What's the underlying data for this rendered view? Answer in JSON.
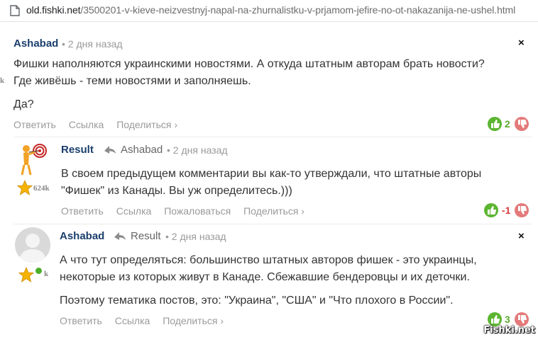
{
  "browser": {
    "url_domain": "old.fishki.net",
    "url_path": "/3500201-v-kieve-neizvestnyj-napal-na-zhurnalistku-v-prjamom-jefire-no-ot-nakazanija-ne-ushel.html"
  },
  "comments": [
    {
      "author": "Ashabad",
      "time": "• 2 дня назад",
      "rating_partial": "k",
      "body": [
        "Фишки наполняются украинскими новостями. А откуда штатным авторам брать новости?",
        "Где живёшь - теми новостями и заполняешь.",
        "Да?"
      ],
      "actions": [
        "Ответить",
        "Ссылка",
        "Поделиться ›"
      ],
      "score": "2",
      "close_label": "×"
    },
    {
      "author": "Result",
      "reply_to": "Ashabad",
      "time": "• 2 дня назад",
      "rating": "624k",
      "body": [
        "В своем предыдущем комментарии вы как-то утверждали, что штатные авторы",
        "\"Фишек\" из Канады. Вы уж определитесь.)))"
      ],
      "actions": [
        "Ответить",
        "Ссылка",
        "Пожаловаться",
        "Поделиться ›"
      ],
      "score": "-1"
    },
    {
      "author": "Ashabad",
      "reply_to": "Result",
      "time": "• 2 дня назад",
      "rating_partial": "k",
      "body": [
        "А что тут определяться: большинство штатных авторов фишек - это украинцы,",
        "некоторые из которых живут в Канаде. Сбежавшие бендеровцы и их деточки.",
        "Поэтому тематика постов, это: \"Украина\", \"США\" и \"Что плохого в России\"."
      ],
      "actions": [
        "Ответить",
        "Ссылка",
        "Поделиться ›"
      ],
      "score": "3",
      "close_label": "×"
    }
  ],
  "watermark": "Fishki.net",
  "colors": {
    "author": "#1b3f6d",
    "vote_up": "#5cb531",
    "vote_down": "#e47a7a",
    "score_positive": "#5aa82c",
    "score_negative": "#d6393a"
  }
}
